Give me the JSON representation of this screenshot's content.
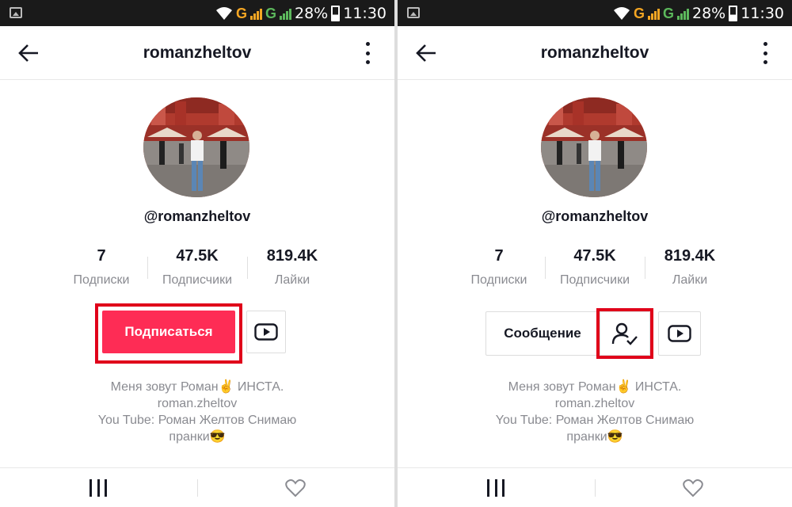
{
  "status_bar": {
    "battery": "28%",
    "time": "11:30",
    "network_left": "G",
    "network_right": "G"
  },
  "header": {
    "title": "romanzheltov"
  },
  "profile": {
    "handle": "@romanzheltov",
    "stats": [
      {
        "value": "7",
        "label": "Подписки"
      },
      {
        "value": "47.5K",
        "label": "Подписчики"
      },
      {
        "value": "819.4K",
        "label": "Лайки"
      }
    ],
    "bio": [
      "Меня зовут Роман✌️ ИНСТА.",
      "roman.zheltov",
      "You Tube: Роман Желтов Снимаю",
      "пранки😎"
    ]
  },
  "left_screen": {
    "follow_label": "Подписаться"
  },
  "right_screen": {
    "message_label": "Сообщение"
  },
  "colors": {
    "accent": "#fe2c55",
    "highlight": "#e0001a",
    "text": "#161823",
    "muted": "#8a8b91"
  }
}
